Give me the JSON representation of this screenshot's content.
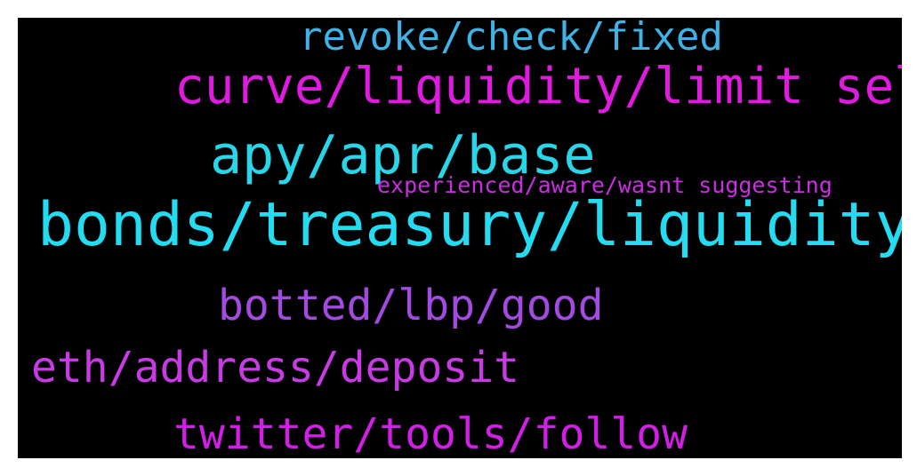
{
  "background_color": "#000000",
  "words": [
    {
      "text": "revoke/check/fixed",
      "color": "#3fb2e6"
    },
    {
      "text": "curve/liquidity/limit sell",
      "color": "#e01ae0"
    },
    {
      "text": "apy/apr/base",
      "color": "#27d6e8"
    },
    {
      "text": "experienced/aware/wasnt suggesting",
      "color": "#c92fe0"
    },
    {
      "text": "bonds/treasury/liquidity",
      "color": "#23dcf2"
    },
    {
      "text": "botted/lbp/good",
      "color": "#a34be0"
    },
    {
      "text": "eth/address/deposit",
      "color": "#c83ae3"
    },
    {
      "text": "twitter/tools/follow",
      "color": "#d21ee6"
    }
  ]
}
